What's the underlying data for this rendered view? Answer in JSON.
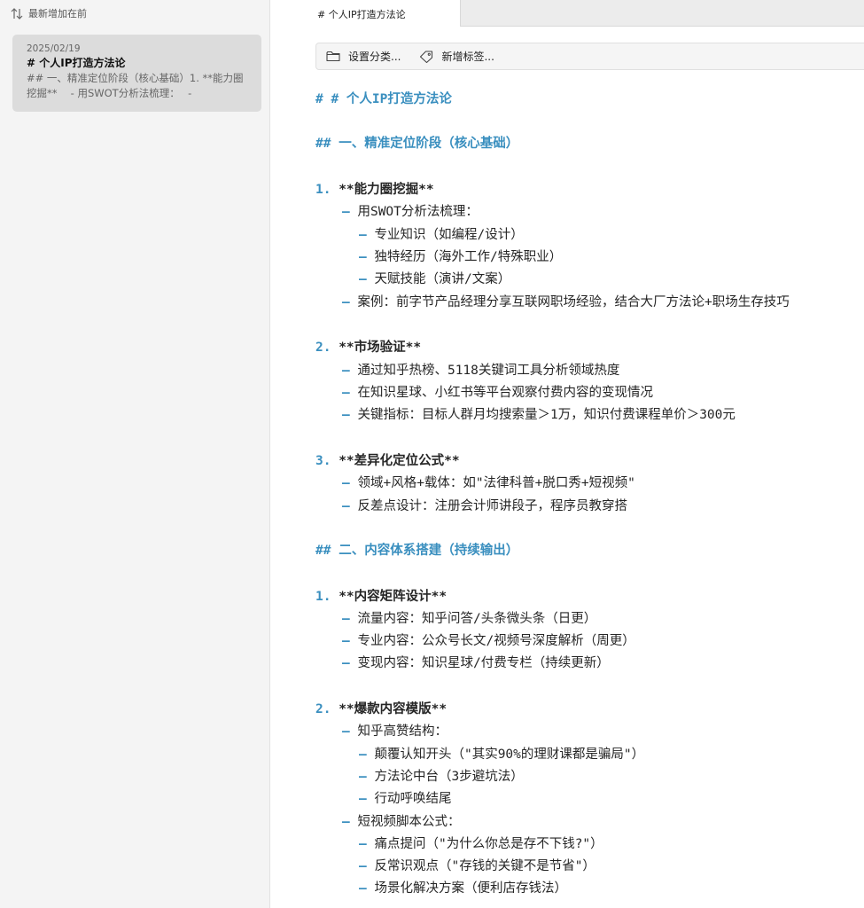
{
  "sidebar": {
    "sort_label": "最新增加在前",
    "note": {
      "date": "2025/02/19",
      "title": "# 个人IP打造方法论",
      "preview": "## 一、精准定位阶段（核心基础）1. **能力圈挖掘**　 - 用SWOT分析法梳理：　 -"
    }
  },
  "tab": {
    "label": "# 个人IP打造方法论"
  },
  "toolbar": {
    "category_label": "设置分类...",
    "tag_label": "新增标签..."
  },
  "doc": {
    "h1": "# 个人IP打造方法论",
    "s1": {
      "heading": "一、精准定位阶段（核心基础）",
      "i1": {
        "num": "1.",
        "title": "**能力圈挖掘**",
        "b1": "用SWOT分析法梳理：",
        "b1a": "专业知识（如编程/设计）",
        "b1b": "独特经历（海外工作/特殊职业）",
        "b1c": "天赋技能（演讲/文案）",
        "b2": "案例：前字节产品经理分享互联网职场经验，结合大厂方法论+职场生存技巧"
      },
      "i2": {
        "num": "2.",
        "title": "**市场验证**",
        "b1": "通过知乎热榜、5118关键词工具分析领域热度",
        "b2": "在知识星球、小红书等平台观察付费内容的变现情况",
        "b3": "关键指标：目标人群月均搜索量＞1万，知识付费课程单价＞300元"
      },
      "i3": {
        "num": "3.",
        "title": "**差异化定位公式**",
        "b1": "领域+风格+载体：如\"法律科普+脱口秀+短视频\"",
        "b2": "反差点设计：注册会计师讲段子，程序员教穿搭"
      }
    },
    "s2": {
      "heading": "二、内容体系搭建（持续输出）",
      "i1": {
        "num": "1.",
        "title": "**内容矩阵设计**",
        "b1": "流量内容：知乎问答/头条微头条（日更）",
        "b2": "专业内容：公众号长文/视频号深度解析（周更）",
        "b3": "变现内容：知识星球/付费专栏（持续更新）"
      },
      "i2": {
        "num": "2.",
        "title": "**爆款内容模版**",
        "b1": "知乎高赞结构：",
        "b1a": "颠覆认知开头（\"其实90%的理财课都是骗局\"）",
        "b1b": "方法论中台（3步避坑法）",
        "b1c": "行动呼唤结尾",
        "b2": "短视频脚本公式：",
        "b2a": "痛点提问（\"为什么你总是存不下钱?\"）",
        "b2b": "反常识观点（\"存钱的关键不是节省\"）",
        "b2c": "场景化解决方案（便利店存钱法）"
      }
    }
  },
  "colors": {
    "accent": "#3a8fbf",
    "sidebar_bg": "#f4f4f4",
    "card_selected": "#dcdcdc"
  }
}
